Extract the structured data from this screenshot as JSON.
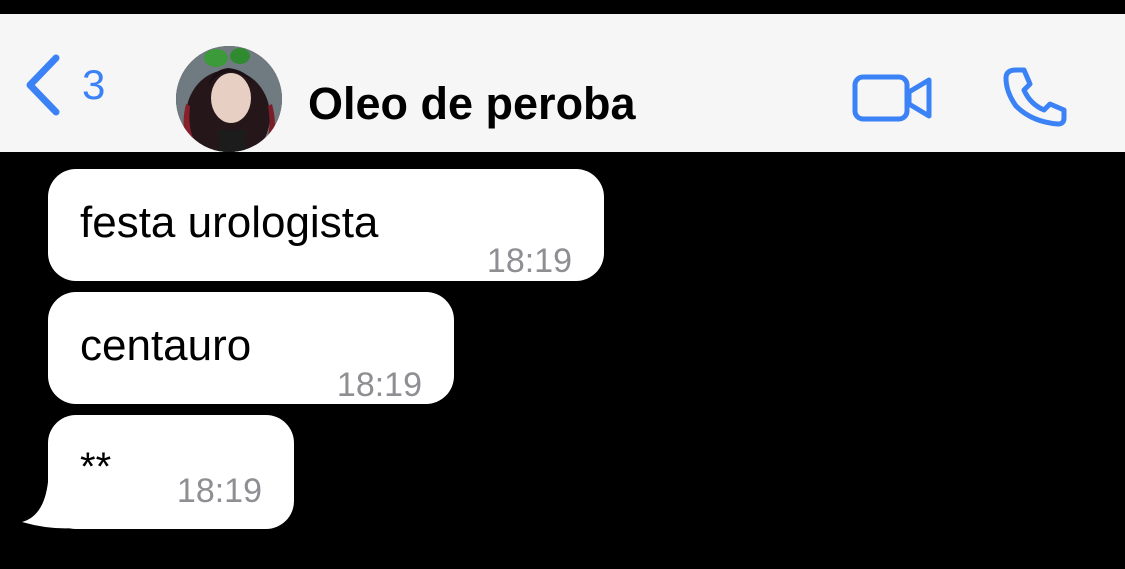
{
  "header": {
    "back_count": "3",
    "contact_name": "Oleo de peroba",
    "back_icon": "chevron-left-icon",
    "video_icon": "video-camera-icon",
    "call_icon": "phone-icon",
    "accent_color": "#3b82f6"
  },
  "messages": [
    {
      "text": "festa urologista",
      "time": "18:19",
      "direction": "incoming"
    },
    {
      "text": "centauro",
      "time": "18:19",
      "direction": "incoming"
    },
    {
      "text": "**",
      "time": "18:19",
      "direction": "incoming"
    }
  ],
  "colors": {
    "background": "#000000",
    "header_bg": "#f6f6f6",
    "bubble_bg": "#ffffff",
    "timestamp": "#8e8e93"
  }
}
